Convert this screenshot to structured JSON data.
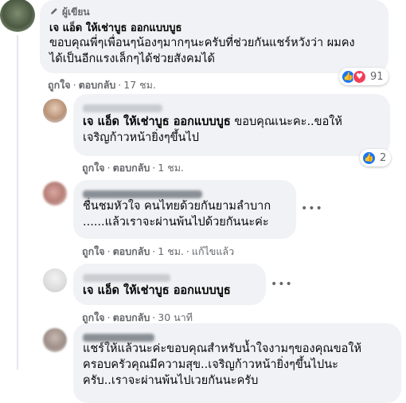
{
  "comments": [
    {
      "author_badge": "ผู้เขียน",
      "author": "เจ แอ็ด ให้เช่าบูธ ออกแบบบูธ",
      "text_line1": "ขอบคุณพี่ๆเพื่อนๆน้องๆมากๆนะครับที่ช่วยกันแชร์หวังว่า ผมคง",
      "text_line2": "ได้เป็นอีกแรงเล็กๆได้ช่วยสังคมได้",
      "like": "ถูกใจ",
      "reply": "ตอบกลับ",
      "time": "17 ชม.",
      "reaction_count": "91"
    },
    {
      "author_mention": "เจ แอ็ด ให้เช่าบูธ ออกแบบบูธ",
      "text_after_mention": "ขอบคุณเนะคะ..ขอให้",
      "text_line2": "เจริญก้าวหน้ายิ่งๆขึ้นไป",
      "like": "ถูกใจ",
      "reply": "ตอบกลับ",
      "time": "1 ชม.",
      "reaction_count": "2"
    },
    {
      "text_line1": "ชื่นชมหัวใจ คนไทยด้วยกันยามลำบาก",
      "text_line2": "......แล้วเราจะผ่านพ้นไปด้วยกันนะค่ะ",
      "like": "ถูกใจ",
      "reply": "ตอบกลับ",
      "time": "1 ชม.",
      "edited": "แก้ไขแล้ว"
    },
    {
      "author_mention": "เจ แอ็ด ให้เช่าบูธ ออกแบบบูธ",
      "like": "ถูกใจ",
      "reply": "ตอบกลับ",
      "time": "30 นาที"
    },
    {
      "text_line1": "แชร์ให้แล้วนะค่ะขอบคุณสำหรับน้ำใจงามๆของคุณขอให้",
      "text_line2": "ครอบครัวคุณมีความสุข..เจริญก้าวหน้ายิ่งๆขึ้นไปนะ",
      "text_line3": "ครับ..เราจะผ่านพ้นไปเวยกันนะครับ"
    }
  ],
  "icons": {
    "more": "more-options-icon",
    "like": "like-reaction-icon",
    "love": "love-reaction-icon",
    "pen": "pen-icon"
  },
  "colors": {
    "bubble": "#f0f2f5",
    "meta": "#65676b",
    "like": "#1877f2",
    "love": "#f33e58"
  }
}
